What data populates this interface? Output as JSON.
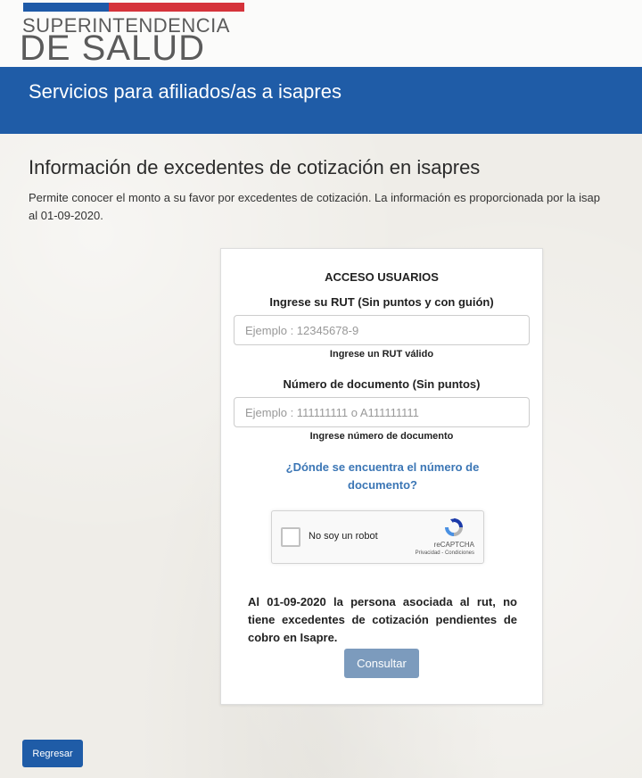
{
  "header": {
    "logo_line1": "SUPERINTENDENCIA",
    "logo_line2": "DE SALUD",
    "banner_title": "Servicios para afiliados/as a isapres"
  },
  "main": {
    "title": "Información de excedentes de cotización en isapres",
    "description_line1": "Permite conocer el monto a su favor por excedentes de cotización. La información es proporcionada por la isap",
    "description_line2": "al 01-09-2020."
  },
  "form": {
    "title": "ACCESO USUARIOS",
    "rut_label": "Ingrese su RUT  (Sin puntos y con guión)",
    "rut_placeholder": "Ejemplo : 12345678-9",
    "rut_value": "",
    "rut_hint": "Ingrese un RUT válido",
    "doc_label": "Número de documento (Sin puntos)",
    "doc_placeholder": "Ejemplo : 111111111 o A111111111",
    "doc_value": "",
    "doc_hint": "Ingrese número de documento",
    "help_link": "¿Dónde se encuentra el número de documento?",
    "captcha": {
      "label": "No soy un robot",
      "brand": "reCAPTCHA",
      "links": "Privacidad - Condiciones"
    },
    "result_message": "Al 01-09-2020 la persona asociada al rut, no tiene excedentes de cotización pendientes de cobro en Isapre.",
    "submit_label": "Consultar"
  },
  "footer": {
    "back_label": "Regresar"
  },
  "colors": {
    "brand_blue": "#1f5ca7",
    "brand_red": "#d5333b",
    "link_blue": "#3b76b5",
    "disabled_button": "#7c9bbd"
  }
}
